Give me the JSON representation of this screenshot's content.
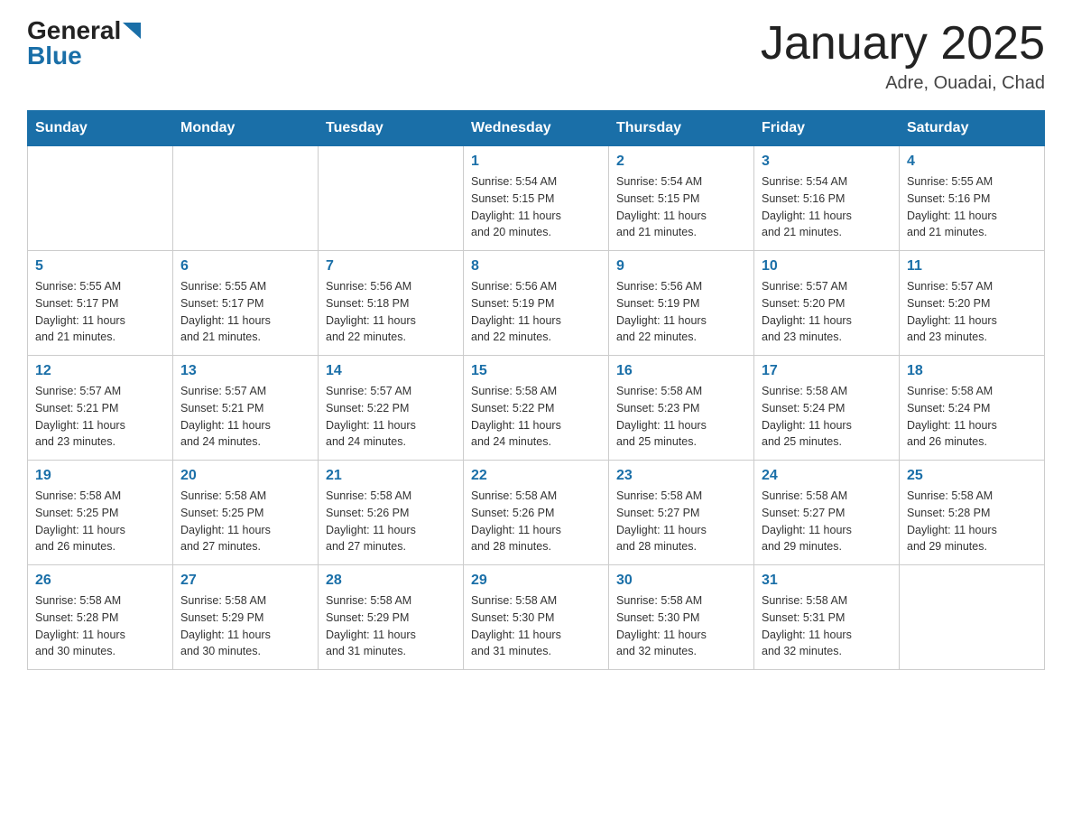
{
  "header": {
    "logo_general": "General",
    "logo_blue": "Blue",
    "month_title": "January 2025",
    "location": "Adre, Ouadai, Chad"
  },
  "weekdays": [
    "Sunday",
    "Monday",
    "Tuesday",
    "Wednesday",
    "Thursday",
    "Friday",
    "Saturday"
  ],
  "weeks": [
    [
      {
        "day": "",
        "info": ""
      },
      {
        "day": "",
        "info": ""
      },
      {
        "day": "",
        "info": ""
      },
      {
        "day": "1",
        "info": "Sunrise: 5:54 AM\nSunset: 5:15 PM\nDaylight: 11 hours\nand 20 minutes."
      },
      {
        "day": "2",
        "info": "Sunrise: 5:54 AM\nSunset: 5:15 PM\nDaylight: 11 hours\nand 21 minutes."
      },
      {
        "day": "3",
        "info": "Sunrise: 5:54 AM\nSunset: 5:16 PM\nDaylight: 11 hours\nand 21 minutes."
      },
      {
        "day": "4",
        "info": "Sunrise: 5:55 AM\nSunset: 5:16 PM\nDaylight: 11 hours\nand 21 minutes."
      }
    ],
    [
      {
        "day": "5",
        "info": "Sunrise: 5:55 AM\nSunset: 5:17 PM\nDaylight: 11 hours\nand 21 minutes."
      },
      {
        "day": "6",
        "info": "Sunrise: 5:55 AM\nSunset: 5:17 PM\nDaylight: 11 hours\nand 21 minutes."
      },
      {
        "day": "7",
        "info": "Sunrise: 5:56 AM\nSunset: 5:18 PM\nDaylight: 11 hours\nand 22 minutes."
      },
      {
        "day": "8",
        "info": "Sunrise: 5:56 AM\nSunset: 5:19 PM\nDaylight: 11 hours\nand 22 minutes."
      },
      {
        "day": "9",
        "info": "Sunrise: 5:56 AM\nSunset: 5:19 PM\nDaylight: 11 hours\nand 22 minutes."
      },
      {
        "day": "10",
        "info": "Sunrise: 5:57 AM\nSunset: 5:20 PM\nDaylight: 11 hours\nand 23 minutes."
      },
      {
        "day": "11",
        "info": "Sunrise: 5:57 AM\nSunset: 5:20 PM\nDaylight: 11 hours\nand 23 minutes."
      }
    ],
    [
      {
        "day": "12",
        "info": "Sunrise: 5:57 AM\nSunset: 5:21 PM\nDaylight: 11 hours\nand 23 minutes."
      },
      {
        "day": "13",
        "info": "Sunrise: 5:57 AM\nSunset: 5:21 PM\nDaylight: 11 hours\nand 24 minutes."
      },
      {
        "day": "14",
        "info": "Sunrise: 5:57 AM\nSunset: 5:22 PM\nDaylight: 11 hours\nand 24 minutes."
      },
      {
        "day": "15",
        "info": "Sunrise: 5:58 AM\nSunset: 5:22 PM\nDaylight: 11 hours\nand 24 minutes."
      },
      {
        "day": "16",
        "info": "Sunrise: 5:58 AM\nSunset: 5:23 PM\nDaylight: 11 hours\nand 25 minutes."
      },
      {
        "day": "17",
        "info": "Sunrise: 5:58 AM\nSunset: 5:24 PM\nDaylight: 11 hours\nand 25 minutes."
      },
      {
        "day": "18",
        "info": "Sunrise: 5:58 AM\nSunset: 5:24 PM\nDaylight: 11 hours\nand 26 minutes."
      }
    ],
    [
      {
        "day": "19",
        "info": "Sunrise: 5:58 AM\nSunset: 5:25 PM\nDaylight: 11 hours\nand 26 minutes."
      },
      {
        "day": "20",
        "info": "Sunrise: 5:58 AM\nSunset: 5:25 PM\nDaylight: 11 hours\nand 27 minutes."
      },
      {
        "day": "21",
        "info": "Sunrise: 5:58 AM\nSunset: 5:26 PM\nDaylight: 11 hours\nand 27 minutes."
      },
      {
        "day": "22",
        "info": "Sunrise: 5:58 AM\nSunset: 5:26 PM\nDaylight: 11 hours\nand 28 minutes."
      },
      {
        "day": "23",
        "info": "Sunrise: 5:58 AM\nSunset: 5:27 PM\nDaylight: 11 hours\nand 28 minutes."
      },
      {
        "day": "24",
        "info": "Sunrise: 5:58 AM\nSunset: 5:27 PM\nDaylight: 11 hours\nand 29 minutes."
      },
      {
        "day": "25",
        "info": "Sunrise: 5:58 AM\nSunset: 5:28 PM\nDaylight: 11 hours\nand 29 minutes."
      }
    ],
    [
      {
        "day": "26",
        "info": "Sunrise: 5:58 AM\nSunset: 5:28 PM\nDaylight: 11 hours\nand 30 minutes."
      },
      {
        "day": "27",
        "info": "Sunrise: 5:58 AM\nSunset: 5:29 PM\nDaylight: 11 hours\nand 30 minutes."
      },
      {
        "day": "28",
        "info": "Sunrise: 5:58 AM\nSunset: 5:29 PM\nDaylight: 11 hours\nand 31 minutes."
      },
      {
        "day": "29",
        "info": "Sunrise: 5:58 AM\nSunset: 5:30 PM\nDaylight: 11 hours\nand 31 minutes."
      },
      {
        "day": "30",
        "info": "Sunrise: 5:58 AM\nSunset: 5:30 PM\nDaylight: 11 hours\nand 32 minutes."
      },
      {
        "day": "31",
        "info": "Sunrise: 5:58 AM\nSunset: 5:31 PM\nDaylight: 11 hours\nand 32 minutes."
      },
      {
        "day": "",
        "info": ""
      }
    ]
  ]
}
